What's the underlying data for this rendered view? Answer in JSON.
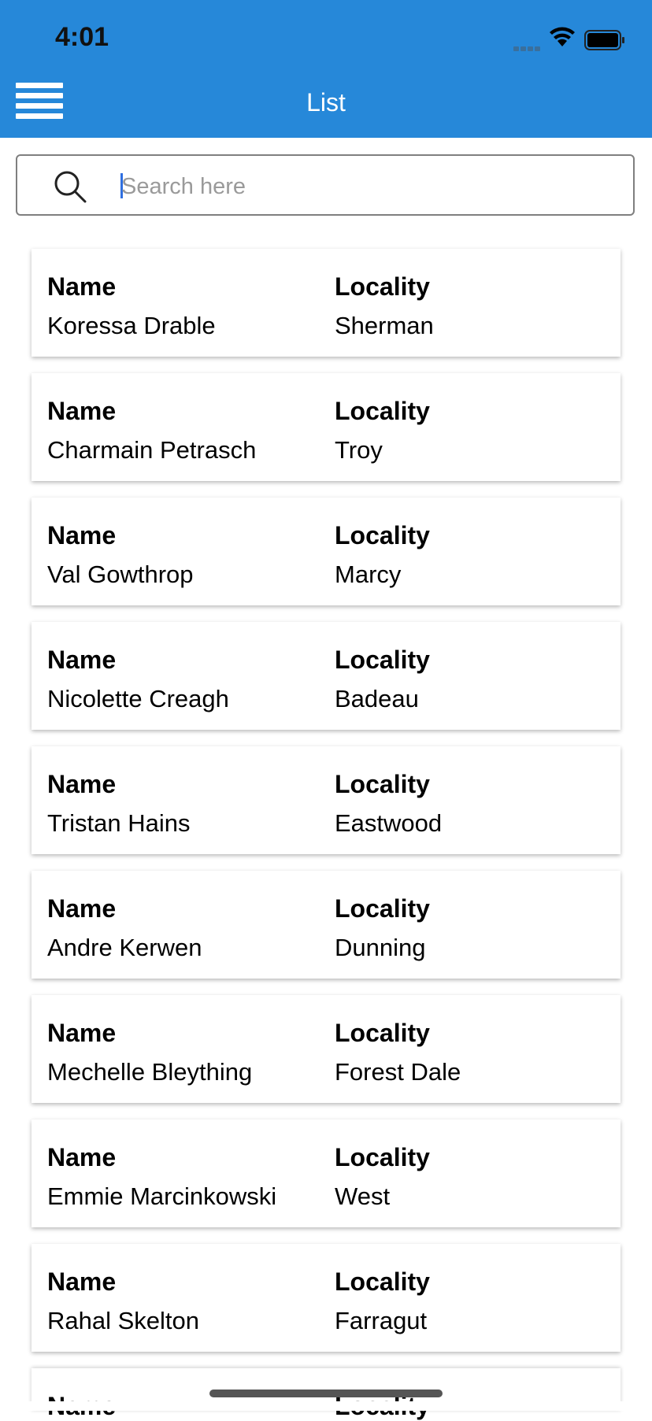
{
  "status_bar": {
    "time": "4:01"
  },
  "nav": {
    "title": "List"
  },
  "search": {
    "placeholder": "Search here",
    "value": ""
  },
  "colors": {
    "header": "#2688d9",
    "search_caret": "#2f6fe0"
  },
  "list": {
    "items": [
      {
        "name_label": "Name",
        "name": "Koressa Drable",
        "locality_label": "Locality",
        "locality": "Sherman"
      },
      {
        "name_label": "Name",
        "name": "Charmain Petrasch",
        "locality_label": "Locality",
        "locality": "Troy"
      },
      {
        "name_label": "Name",
        "name": "Val Gowthrop",
        "locality_label": "Locality",
        "locality": "Marcy"
      },
      {
        "name_label": "Name",
        "name": "Nicolette Creagh",
        "locality_label": "Locality",
        "locality": "Badeau"
      },
      {
        "name_label": "Name",
        "name": "Tristan Hains",
        "locality_label": "Locality",
        "locality": "Eastwood"
      },
      {
        "name_label": "Name",
        "name": "Andre Kerwen",
        "locality_label": "Locality",
        "locality": "Dunning"
      },
      {
        "name_label": "Name",
        "name": "Mechelle Bleything",
        "locality_label": "Locality",
        "locality": "Forest Dale"
      },
      {
        "name_label": "Name",
        "name": "Emmie Marcinkowski",
        "locality_label": "Locality",
        "locality": "West"
      },
      {
        "name_label": "Name",
        "name": "Rahal Skelton",
        "locality_label": "Locality",
        "locality": "Farragut"
      },
      {
        "name_label": "Name",
        "name": "",
        "locality_label": "Locality",
        "locality": ""
      }
    ]
  }
}
